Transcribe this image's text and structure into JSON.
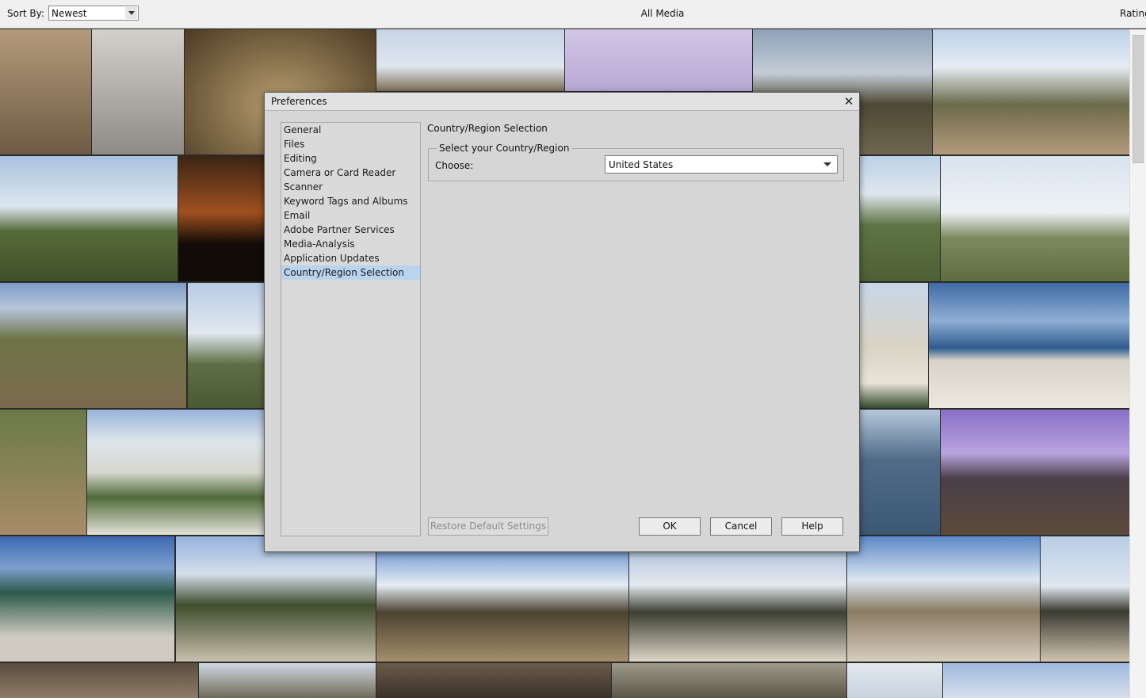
{
  "toolbar": {
    "sort_label": "Sort By:",
    "sort_value": "Newest",
    "title": "All Media",
    "rating_label": "Rating"
  },
  "dialog": {
    "title": "Preferences",
    "categories": [
      "General",
      "Files",
      "Editing",
      "Camera or Card Reader",
      "Scanner",
      "Keyword Tags and Albums",
      "Email",
      "Adobe Partner Services",
      "Media-Analysis",
      "Application Updates",
      "Country/Region Selection"
    ],
    "selected_category": "Country/Region Selection",
    "panel_heading": "Country/Region Selection",
    "group_legend": "Select your Country/Region",
    "choose_label": "Choose:",
    "country_value": "United States",
    "buttons": {
      "restore": "Restore Default Settings",
      "ok": "OK",
      "cancel": "Cancel",
      "help": "Help"
    }
  },
  "colors": {
    "selected_item_bg": "#b9d4ee",
    "dialog_bg": "#d6d6d6"
  }
}
